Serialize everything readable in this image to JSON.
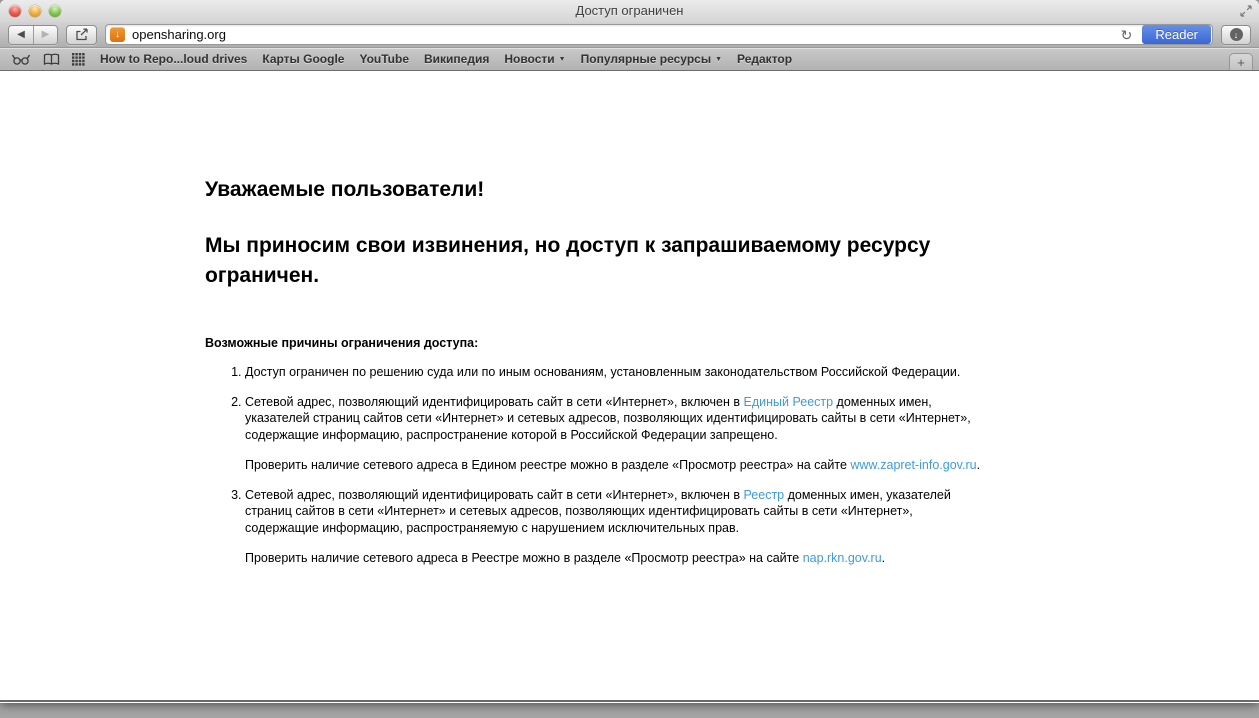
{
  "window": {
    "title": "Доступ ограничен"
  },
  "toolbar": {
    "url": "opensharing.org",
    "reader_label": "Reader"
  },
  "icons": {
    "back": "◀",
    "forward": "▶",
    "refresh": "↻",
    "favicon_arrow": "↓",
    "download_arrow": "↓",
    "new_tab": "+",
    "disclosure": "▼"
  },
  "bookmarks": {
    "items": [
      {
        "label": "How to Repo...loud drives",
        "has_menu": false
      },
      {
        "label": "Карты Google",
        "has_menu": false
      },
      {
        "label": "YouTube",
        "has_menu": false
      },
      {
        "label": "Википедия",
        "has_menu": false
      },
      {
        "label": "Новости",
        "has_menu": true
      },
      {
        "label": "Популярные ресурсы",
        "has_menu": true
      },
      {
        "label": "Редактор",
        "has_menu": false
      }
    ]
  },
  "page": {
    "heading1": "Уважаемые пользователи!",
    "heading2": "Мы приносим свои извинения, но доступ к запрашиваемому ресурсу ограничен.",
    "reasons_title": "Возможные причины ограничения доступа:",
    "items": [
      {
        "text": "Доступ ограничен  по решению суда или по иным основаниям, установленным законодательством Российской Федерации."
      },
      {
        "pre": "Сетевой адрес, позволяющий идентифицировать сайт в сети «Интернет», включен в ",
        "link": "Единый Реестр",
        "post": " доменных имен, указателей страниц сайтов сети «Интернет» и сетевых адресов, позволяющих идентифицировать сайты в сети «Интернет», содержащие информацию, распространение которой в Российской Федерации запрещено.",
        "note_pre": "Проверить наличие сетевого адреса в Едином реестре можно в разделе «Просмотр реестра» на сайте ",
        "note_link": "www.zapret-info.gov.ru",
        "note_post": "."
      },
      {
        "pre": "Сетевой адрес, позволяющий идентифицировать сайт в сети «Интернет», включен в ",
        "link": "Реестр",
        "post": " доменных имен, указателей страниц сайтов в сети «Интернет» и сетевых адресов, позволяющих идентифицировать сайты в сети «Интернет», содержащие информацию, распространяемую с нарушением исключительных прав.",
        "note_pre": "Проверить наличие сетевого адреса в Реестре можно в разделе «Просмотр реестра» на сайте ",
        "note_link": "nap.rkn.gov.ru",
        "note_post": "."
      }
    ]
  },
  "colors": {
    "reader_button_blue": "#4a78dd",
    "link_blue": "#3d9be0",
    "favicon_orange": "#e87d1e",
    "traffic_red": "#d94f44",
    "traffic_yellow": "#e8a033",
    "traffic_green": "#7cc04a"
  }
}
